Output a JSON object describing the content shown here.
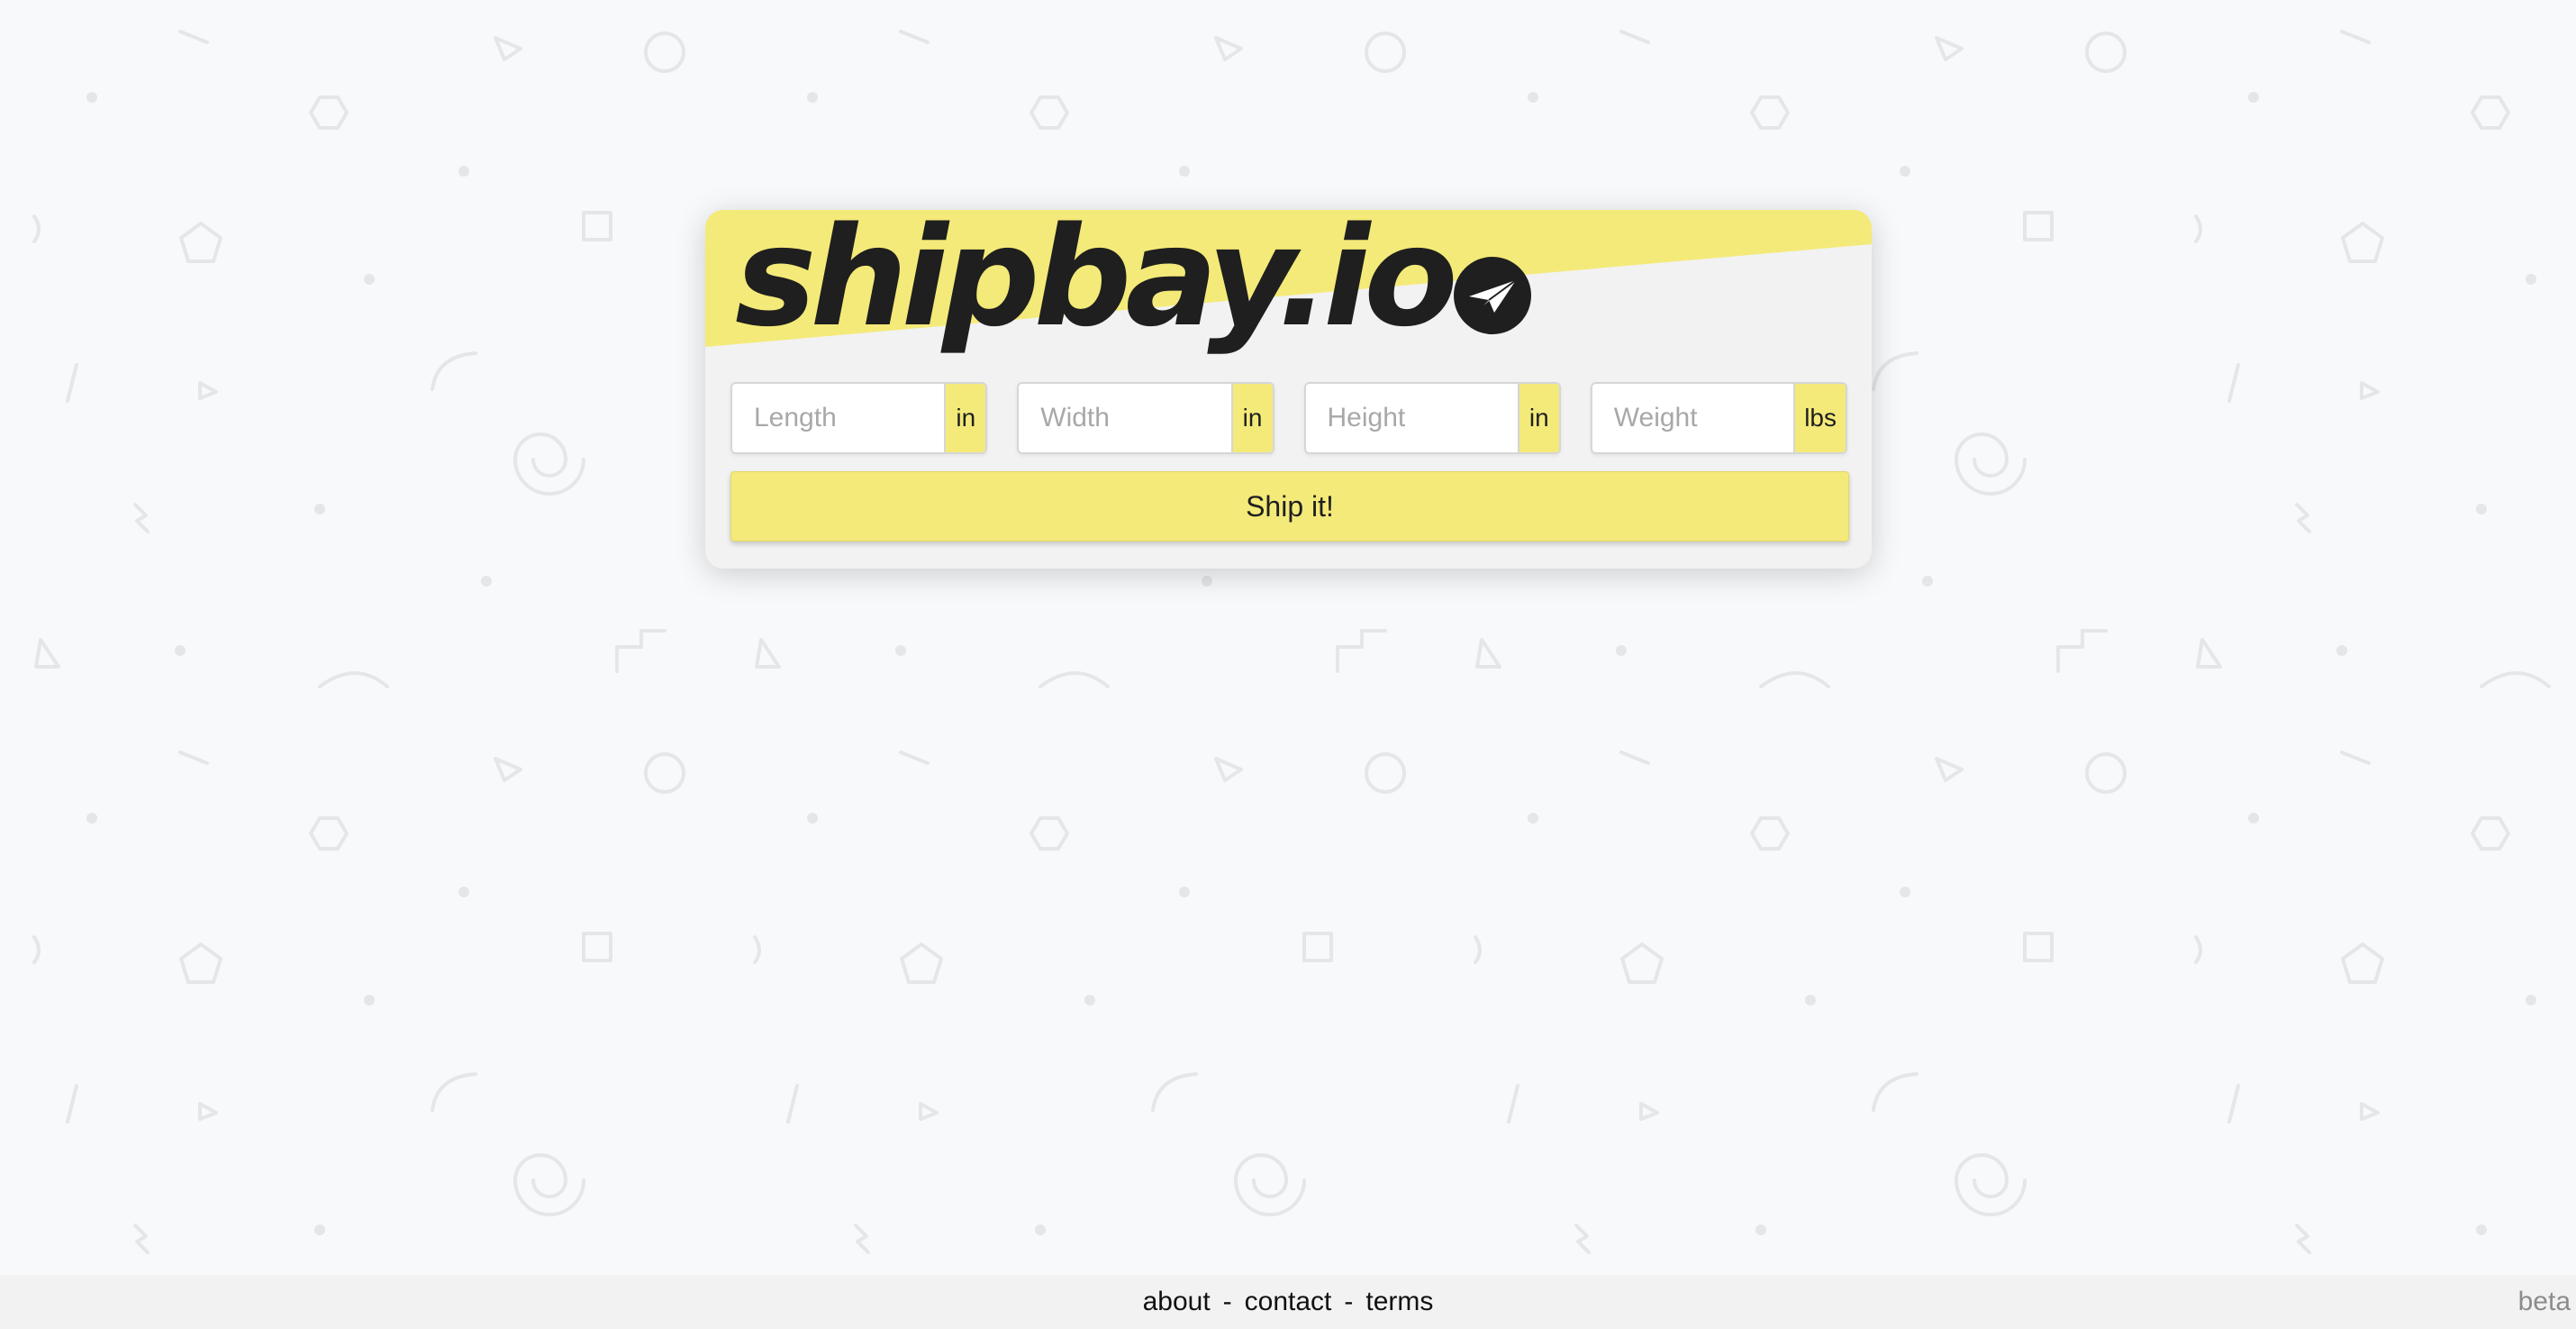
{
  "brand": {
    "name": "shipbay.io",
    "icon": "paper-plane-icon",
    "accent_color": "#f4ea79",
    "dark_color": "#1f1f1f"
  },
  "form": {
    "fields": [
      {
        "placeholder": "Length",
        "value": "",
        "unit": "in"
      },
      {
        "placeholder": "Width",
        "value": "",
        "unit": "in"
      },
      {
        "placeholder": "Height",
        "value": "",
        "unit": "in"
      },
      {
        "placeholder": "Weight",
        "value": "",
        "unit": "lbs"
      }
    ],
    "submit_label": "Ship it!"
  },
  "footer": {
    "links": [
      "about",
      "contact",
      "terms"
    ],
    "separator": "-",
    "badge": "beta"
  },
  "background": {
    "pattern_color": "#e6e8ec"
  }
}
